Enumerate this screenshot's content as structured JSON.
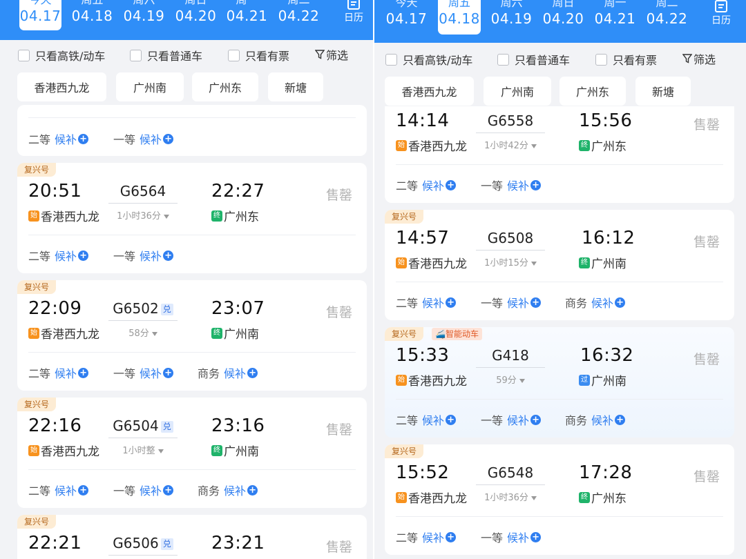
{
  "dates": [
    {
      "weekday": "今天",
      "date": "04.17"
    },
    {
      "weekday": "周五",
      "date": "04.18"
    },
    {
      "weekday": "周六",
      "date": "04.19"
    },
    {
      "weekday": "周日",
      "date": "04.20"
    },
    {
      "weekday": "周一",
      "date": "04.21"
    },
    {
      "weekday": "周二",
      "date": "04.22"
    }
  ],
  "calendar_label": "日历",
  "filters": {
    "hsr_only": "只看高铁/动车",
    "normal_only": "只看普通车",
    "available_only": "只看有票",
    "filter": "筛选"
  },
  "stations": [
    "香港西九龙",
    "广州南",
    "广州东",
    "新塘"
  ],
  "common": {
    "brand": "复兴号",
    "smart_emu": "智能动车",
    "sold_out": "售罄",
    "waitlist": "候补",
    "redeem_tag": "兑",
    "tag_start": "始",
    "tag_end": "终",
    "tag_pass": "过",
    "seat_second": "二等",
    "seat_first": "一等",
    "seat_business": "商务"
  },
  "left_panel": {
    "selected_date": "04.17",
    "trains": [
      {
        "dep": "20:51",
        "no": "G6564",
        "arr": "22:27",
        "duration": "1小时36分",
        "from": "香港西九龙",
        "to": "广州东"
      },
      {
        "dep": "22:09",
        "no": "G6502",
        "arr": "23:07",
        "duration": "58分",
        "from": "香港西九龙",
        "to": "广州南"
      },
      {
        "dep": "22:16",
        "no": "G6504",
        "arr": "23:16",
        "duration": "1小时整",
        "from": "香港西九龙",
        "to": "广州南"
      },
      {
        "dep": "22:21",
        "no": "G6506",
        "arr": "23:21"
      }
    ]
  },
  "right_panel": {
    "selected_date": "04.18",
    "trains": [
      {
        "dep": "14:14",
        "no": "G6558",
        "arr": "15:56",
        "duration": "1小时42分",
        "from": "香港西九龙",
        "to": "广州东"
      },
      {
        "dep": "14:57",
        "no": "G6508",
        "arr": "16:12",
        "duration": "1小时15分",
        "from": "香港西九龙",
        "to": "广州南"
      },
      {
        "dep": "15:33",
        "no": "G418",
        "arr": "16:32",
        "duration": "59分",
        "from": "香港西九龙",
        "to": "广州南"
      },
      {
        "dep": "15:52",
        "no": "G6548",
        "arr": "17:28",
        "duration": "1小时36分",
        "from": "香港西九龙",
        "to": "广州东"
      }
    ]
  }
}
